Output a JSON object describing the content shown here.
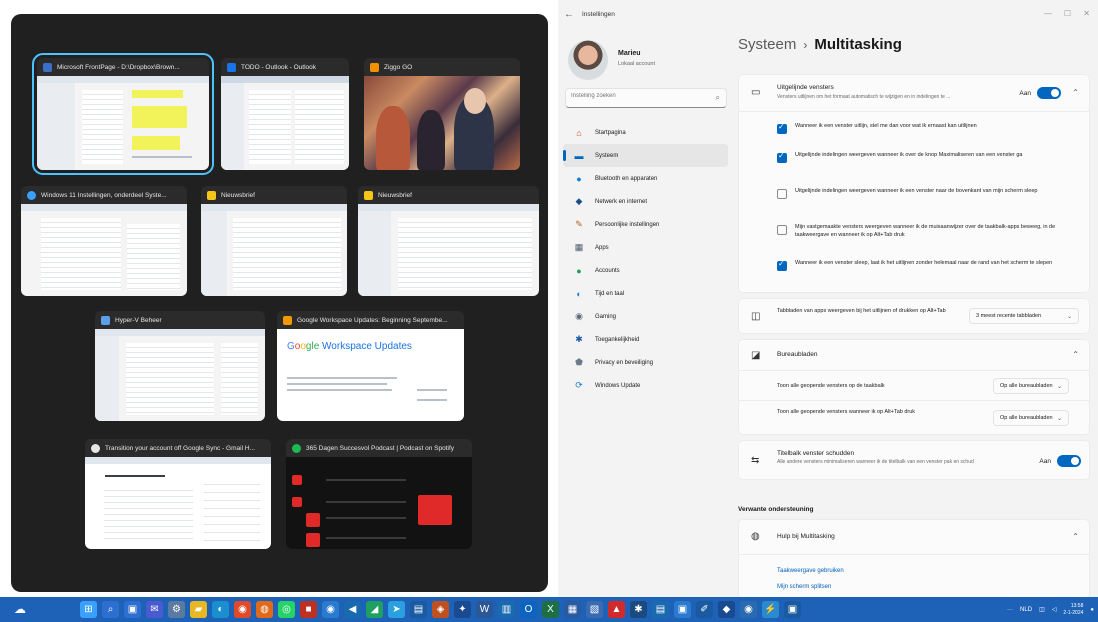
{
  "snap": {
    "windows": [
      {
        "title": "Microsoft FrontPage - D:\\Dropbox\\Brown...",
        "icon_color": "#3b6fc8",
        "selected": true
      },
      {
        "title": "TODO - Outlook - Outlook",
        "icon_color": "#1a73e8"
      },
      {
        "title": "Ziggo GO",
        "icon_color": "#f39200"
      },
      {
        "title": "Windows 11 Instellingen, onderdeel Syste...",
        "icon_color": "#3aa0ff"
      },
      {
        "title": "Nieuwsbrief",
        "icon_color": "#f5c518"
      },
      {
        "title": "Nieuwsbrief",
        "icon_color": "#f5c518"
      },
      {
        "title": "Hyper-V Beheer",
        "icon_color": "#5aa0e6"
      },
      {
        "title": "Google Workspace Updates: Beginning Septembe...",
        "icon_color": "#f29900"
      },
      {
        "title": "Transition your account off Google Sync - Gmail H...",
        "icon_color": "#e6e6e6"
      },
      {
        "title": "365 Dagen Succesvol Podcast | Podcast on Spotify",
        "icon_color": "#1db954"
      }
    ],
    "gw_preview": {
      "g1": "G",
      "g2": "o",
      "g3": "o",
      "g4": "gle",
      "rest": " Workspace Updates"
    }
  },
  "settings": {
    "app_title": "Instellingen",
    "back_icon": "back-arrow-icon",
    "window_controls": [
      "—",
      "☐",
      "✕"
    ],
    "profile": {
      "name": "Marieu",
      "subtitle": "Lokaal account"
    },
    "search": {
      "placeholder": "Instelling zoeken"
    },
    "nav": [
      {
        "label": "Startpagina",
        "icon": "home-icon",
        "glyph": "⌂",
        "color": "#c0541f"
      },
      {
        "label": "Systeem",
        "icon": "system-icon",
        "glyph": "▬",
        "color": "#0067c0",
        "active": true
      },
      {
        "label": "Bluetooth en apparaten",
        "icon": "bluetooth-icon",
        "glyph": "●",
        "color": "#0a7fd8"
      },
      {
        "label": "Netwerk en internet",
        "icon": "network-icon",
        "glyph": "◆",
        "color": "#1b4f8a"
      },
      {
        "label": "Persoonlijke instellingen",
        "icon": "brush-icon",
        "glyph": "✎",
        "color": "#b8621b"
      },
      {
        "label": "Apps",
        "icon": "apps-icon",
        "glyph": "▦",
        "color": "#4a5a6a"
      },
      {
        "label": "Accounts",
        "icon": "accounts-icon",
        "glyph": "●",
        "color": "#1fa05a"
      },
      {
        "label": "Tijd en taal",
        "icon": "time-language-icon",
        "glyph": "◐",
        "color": "#1a7fd0"
      },
      {
        "label": "Gaming",
        "icon": "gaming-icon",
        "glyph": "◉",
        "color": "#5a6a7a"
      },
      {
        "label": "Toegankelijkheid",
        "icon": "accessibility-icon",
        "glyph": "✱",
        "color": "#1a5aa8"
      },
      {
        "label": "Privacy en beveiliging",
        "icon": "shield-icon",
        "glyph": "⬟",
        "color": "#6a7a8a"
      },
      {
        "label": "Windows Update",
        "icon": "windows-update-icon",
        "glyph": "⟳",
        "color": "#1a7fd0"
      }
    ],
    "breadcrumb": {
      "parent": "Systeem",
      "separator": "›",
      "current": "Multitasking"
    },
    "snap_windows": {
      "title": "Uitgelijnde vensters",
      "desc": "Vensters uitlijnen om het formaat automatisch te wijzigen en in indelingen te ...",
      "toggle_label": "Aan",
      "toggle_on": true,
      "options": [
        {
          "text": "Wanneer ik een venster uitlijn, stel me dan voor wat ik ernaast kan uitlijnen",
          "checked": true
        },
        {
          "text": "Uitgelijnde indelingen weergeven wanneer ik over de knop Maximaliseren van een venster ga",
          "checked": true
        },
        {
          "text": "Uitgelijnde indelingen weergeven wanneer ik een venster naar de bovenkant van mijn scherm sleep",
          "checked": false
        },
        {
          "text": "Mijn vastgemaakte vensters weergeven wanneer ik de muisaanwijzer over de taakbalk-apps beweeg, in de taakweergave en wanneer ik op Alt+Tab druk",
          "checked": false
        },
        {
          "text": "Wanneer ik een venster sleep, laat ik het uitlijnen zonder helemaal naar de rand van het scherm te slepen",
          "checked": true
        }
      ]
    },
    "alt_tab": {
      "title": "Tabbladen van apps weergeven bij het uitlijnen of drukken op Alt+Tab",
      "value": "3 meest recente tabbladen"
    },
    "desktops": {
      "title": "Bureaubladen",
      "rows": [
        {
          "label": "Toon alle geopende vensters op de taakbalk",
          "value": "Op alle bureaubladen"
        },
        {
          "label": "Toon alle geopende vensters wanneer ik op Alt+Tab druk",
          "value": "Op alle bureaubladen"
        }
      ]
    },
    "title_shake": {
      "title": "Titelbalk venster schudden",
      "desc": "Alle andere vensters minimaliseren wanneer ik de titelbalk van een venster pak en schud",
      "toggle_label": "Aan",
      "toggle_on": true
    },
    "related": {
      "title": "Verwante ondersteuning",
      "help_title": "Hulp bij Multitasking",
      "links": [
        "Taakweergave gebruiken",
        "Mijn scherm splitsen"
      ]
    }
  },
  "taskbar": {
    "widgets_icon": "widgets-icon",
    "icons": [
      {
        "name": "start-icon",
        "glyph": "⊞",
        "color": "#3aa0ff"
      },
      {
        "name": "search-icon",
        "glyph": "⌕",
        "color": "#2d6fd0"
      },
      {
        "name": "task-view-icon",
        "glyph": "▣",
        "color": "#2d6fd0"
      },
      {
        "name": "chat-icon",
        "glyph": "✉",
        "color": "#4a5ad0"
      },
      {
        "name": "settings-icon",
        "glyph": "⚙",
        "color": "#5a7aa0"
      },
      {
        "name": "file-explorer-icon",
        "glyph": "▰",
        "color": "#e8b824"
      },
      {
        "name": "edge-icon",
        "glyph": "◐",
        "color": "#1a8fd0"
      },
      {
        "name": "chrome-icon",
        "glyph": "◉",
        "color": "#e04a2a"
      },
      {
        "name": "firefox-icon",
        "glyph": "◍",
        "color": "#e06a1a"
      },
      {
        "name": "whatsapp-icon",
        "glyph": "◎",
        "color": "#25d366"
      },
      {
        "name": "app-icon",
        "glyph": "■",
        "color": "#c03020"
      },
      {
        "name": "app-icon",
        "glyph": "◉",
        "color": "#2a7ad0"
      },
      {
        "name": "app-icon",
        "glyph": "◀",
        "color": "#1a6ab0"
      },
      {
        "name": "app-icon",
        "glyph": "◢",
        "color": "#20a060"
      },
      {
        "name": "telegram-icon",
        "glyph": "➤",
        "color": "#2aa0e0"
      },
      {
        "name": "app-icon",
        "glyph": "▤",
        "color": "#1a5aa0"
      },
      {
        "name": "app-icon",
        "glyph": "◈",
        "color": "#c05020"
      },
      {
        "name": "app-icon",
        "glyph": "✦",
        "color": "#1a4a90"
      },
      {
        "name": "word-icon",
        "glyph": "W",
        "color": "#2b5797"
      },
      {
        "name": "app-icon",
        "glyph": "▥",
        "color": "#1a6ab0"
      },
      {
        "name": "outlook-icon",
        "glyph": "O",
        "color": "#0a64c0"
      },
      {
        "name": "excel-icon",
        "glyph": "X",
        "color": "#1d7044"
      },
      {
        "name": "app-icon",
        "glyph": "▦",
        "color": "#2a5aa0"
      },
      {
        "name": "app-icon",
        "glyph": "▧",
        "color": "#3a6ab0"
      },
      {
        "name": "acrobat-icon",
        "glyph": "▲",
        "color": "#d02a2a"
      },
      {
        "name": "app-icon",
        "glyph": "✱",
        "color": "#1a4a80"
      },
      {
        "name": "app-icon",
        "glyph": "▤",
        "color": "#1a6ab0"
      },
      {
        "name": "app-icon",
        "glyph": "▣",
        "color": "#2a7ad0"
      },
      {
        "name": "app-icon",
        "glyph": "✐",
        "color": "#1a5aa0"
      },
      {
        "name": "app-icon",
        "glyph": "◆",
        "color": "#1a4a90"
      },
      {
        "name": "app-icon",
        "glyph": "◉",
        "color": "#2a6ab0"
      },
      {
        "name": "app-icon",
        "glyph": "⚡",
        "color": "#2a8ad0"
      },
      {
        "name": "app-icon",
        "glyph": "▣",
        "color": "#1a5aa0"
      }
    ],
    "tray": {
      "more": "···",
      "lang": "NLD",
      "clock_time": "13:58",
      "clock_date": "2-1-2024"
    }
  }
}
